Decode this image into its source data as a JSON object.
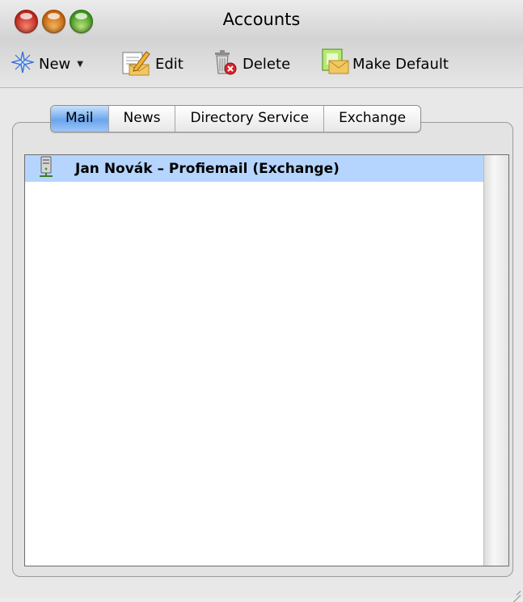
{
  "window": {
    "title": "Accounts"
  },
  "toolbar": {
    "new_label": "New",
    "new_icon": "sparkle-star-icon",
    "edit_label": "Edit",
    "edit_icon": "pencil-envelope-icon",
    "delete_label": "Delete",
    "delete_icon": "trash-delete-icon",
    "make_default_label": "Make Default",
    "make_default_icon": "envelope-default-icon"
  },
  "tabs": [
    {
      "label": "Mail",
      "active": true
    },
    {
      "label": "News",
      "active": false
    },
    {
      "label": "Directory Service",
      "active": false
    },
    {
      "label": "Exchange",
      "active": false
    }
  ],
  "accounts": [
    {
      "name": "Jan Novák – Profiemail (Exchange)",
      "icon": "server-icon",
      "selected": true
    }
  ],
  "colors": {
    "selection": "#b5d5fe",
    "active_tab": "#6aa6ee"
  }
}
